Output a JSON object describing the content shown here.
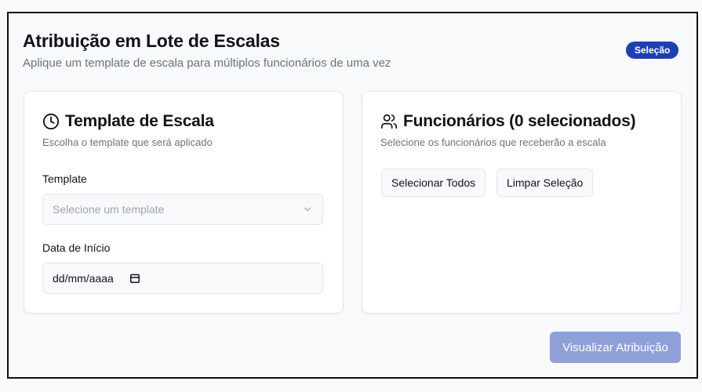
{
  "header": {
    "title": "Atribuição em Lote de Escalas",
    "subtitle": "Aplique um template de escala para múltiplos funcionários de uma vez",
    "badge": "Seleção"
  },
  "template_card": {
    "icon": "clock-icon",
    "title": "Template de Escala",
    "subtitle": "Escolha o template que será aplicado",
    "template_label": "Template",
    "template_placeholder": "Selecione um template",
    "date_label": "Data de Início",
    "date_placeholder": "dd/mm/aaaa"
  },
  "employees_card": {
    "icon": "users-icon",
    "title": "Funcionários (0 selecionados)",
    "subtitle": "Selecione os funcionários que receberão a escala",
    "select_all_label": "Selecionar Todos",
    "clear_selection_label": "Limpar Seleção"
  },
  "footer": {
    "preview_button_label": "Visualizar Atribuição"
  },
  "colors": {
    "badge": "#1e40af",
    "primary_button_disabled": "#8fa0d8"
  }
}
